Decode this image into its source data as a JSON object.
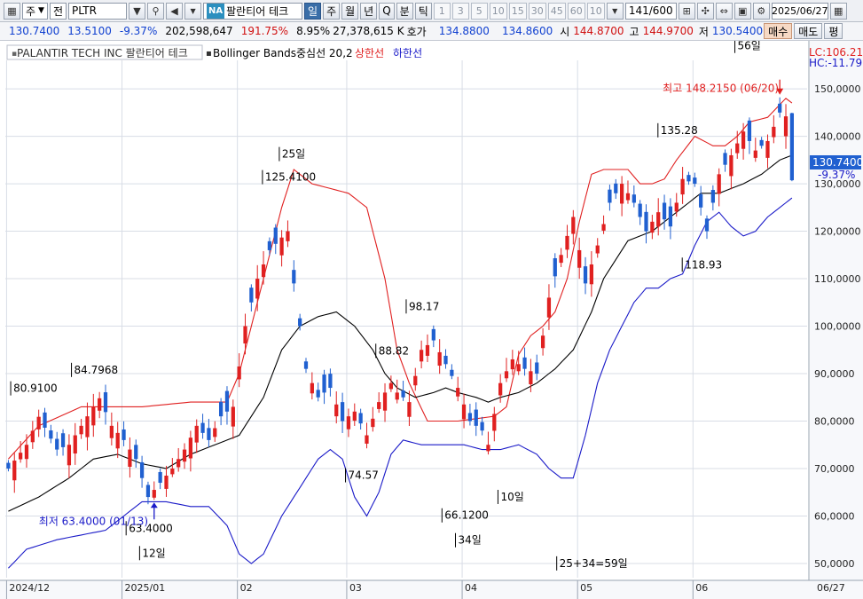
{
  "toolbar": {
    "mode1": "주",
    "mode2": "전",
    "symbol": "PLTR",
    "exchange_badge": "NA",
    "stock_name": "팔란티어 테크",
    "periods": [
      "일",
      "주",
      "월",
      "년",
      "Q",
      "분",
      "틱"
    ],
    "selected_period": "일",
    "intervals": [
      "1",
      "3",
      "5",
      "10",
      "15",
      "30",
      "45",
      "60",
      "10"
    ],
    "count": "141",
    "count_total": "/600",
    "date": "2025/06/27"
  },
  "quote": {
    "price": "130.7400",
    "change": "13.5100",
    "change_pct": "-9.37%",
    "volume": "202,598,647",
    "vol_ratio": "191.75%",
    "turnover_pct": "8.95%",
    "amount": "27,378,615 K",
    "bidask_label": "호가",
    "bid": "134.8800",
    "ask": "134.8600",
    "open_label": "시",
    "open": "144.8700",
    "high_label": "고",
    "high": "144.9700",
    "low_label": "저",
    "low": "130.5400",
    "buy_label": "매수",
    "sell_label": "매도",
    "eval_label": "평"
  },
  "legend": {
    "name": "PALANTIR TECH INC  팔란티어 테크",
    "bb_label": "Bollinger Bands중심선 20,2",
    "upper_label": "상한선",
    "lower_label": "하한선"
  },
  "right_badges": {
    "lc": "LC:106.21",
    "hc": "HC:-11.79",
    "last_price": "130.7400",
    "last_pct": "-9.37%"
  },
  "chart_data": {
    "type": "candlestick",
    "ylim": [
      47,
      156
    ],
    "y_ticks": [
      "150,0000",
      "140,0000",
      "130,0000",
      "120,0000",
      "110,0000",
      "100,0000",
      "90,0000",
      "80,0000",
      "70,0000",
      "60,0000",
      "50,0000"
    ],
    "y_tick_values": [
      150,
      140,
      130,
      120,
      110,
      100,
      90,
      80,
      70,
      60,
      50
    ],
    "x_labels": [
      "2024/12",
      "2025/01",
      "02",
      "03",
      "04",
      "05",
      "06",
      "06/27"
    ],
    "x_label_index": [
      0,
      19,
      38,
      56,
      75,
      94,
      113,
      132
    ],
    "n_candles": 130,
    "colors": {
      "up": "#e02020",
      "down": "#2060d0",
      "mid": "#000000",
      "upper": "#e02020",
      "lower": "#1a1ac8",
      "grid": "#d8dde6"
    },
    "anchors": {
      "close": [
        [
          0,
          70
        ],
        [
          3,
          75
        ],
        [
          5,
          80.9
        ],
        [
          8,
          74
        ],
        [
          10,
          75
        ],
        [
          13,
          81
        ],
        [
          15,
          84.8
        ],
        [
          17,
          79
        ],
        [
          19,
          76
        ],
        [
          21,
          72
        ],
        [
          23,
          64
        ],
        [
          25,
          67
        ],
        [
          27,
          70
        ],
        [
          29,
          74
        ],
        [
          31,
          79
        ],
        [
          33,
          76
        ],
        [
          35,
          81
        ],
        [
          37,
          83
        ],
        [
          39,
          100
        ],
        [
          41,
          110
        ],
        [
          43,
          116
        ],
        [
          46,
          120
        ],
        [
          47,
          109
        ],
        [
          49,
          91
        ],
        [
          51,
          85
        ],
        [
          53,
          87
        ],
        [
          55,
          80
        ],
        [
          57,
          82
        ],
        [
          59,
          77
        ],
        [
          61,
          84
        ],
        [
          63,
          88
        ],
        [
          64,
          86
        ],
        [
          66,
          84
        ],
        [
          68,
          95
        ],
        [
          70,
          97
        ],
        [
          72,
          92
        ],
        [
          74,
          87
        ],
        [
          76,
          80
        ],
        [
          78,
          78
        ],
        [
          79,
          75
        ],
        [
          81,
          88
        ],
        [
          83,
          93
        ],
        [
          85,
          91
        ],
        [
          87,
          90
        ],
        [
          89,
          106
        ],
        [
          91,
          115
        ],
        [
          93,
          123
        ],
        [
          95,
          109
        ],
        [
          97,
          117
        ],
        [
          99,
          126
        ],
        [
          101,
          130
        ],
        [
          103,
          126
        ],
        [
          105,
          120
        ],
        [
          107,
          124
        ],
        [
          109,
          121
        ],
        [
          111,
          131
        ],
        [
          113,
          130
        ],
        [
          115,
          120
        ],
        [
          117,
          132
        ],
        [
          119,
          136
        ],
        [
          121,
          141
        ],
        [
          123,
          137
        ],
        [
          125,
          139
        ],
        [
          127,
          145
        ],
        [
          128,
          144.2
        ],
        [
          129,
          130.74
        ]
      ],
      "upper": [
        [
          0,
          72
        ],
        [
          5,
          79
        ],
        [
          12,
          83
        ],
        [
          16,
          83
        ],
        [
          22,
          83
        ],
        [
          30,
          84
        ],
        [
          36,
          84
        ],
        [
          38,
          90
        ],
        [
          42,
          110
        ],
        [
          45,
          125
        ],
        [
          47,
          133
        ],
        [
          50,
          130
        ],
        [
          56,
          128
        ],
        [
          59,
          125
        ],
        [
          62,
          110
        ],
        [
          64,
          95
        ],
        [
          66,
          88
        ],
        [
          69,
          80
        ],
        [
          74,
          80
        ],
        [
          80,
          81
        ],
        [
          82,
          83
        ],
        [
          84,
          94
        ],
        [
          86,
          98
        ],
        [
          88,
          100
        ],
        [
          90,
          103
        ],
        [
          92,
          110
        ],
        [
          94,
          122
        ],
        [
          96,
          132
        ],
        [
          98,
          133
        ],
        [
          100,
          133
        ],
        [
          102,
          133
        ],
        [
          104,
          130
        ],
        [
          106,
          130
        ],
        [
          108,
          131
        ],
        [
          110,
          135
        ],
        [
          113,
          140
        ],
        [
          116,
          138
        ],
        [
          118,
          138
        ],
        [
          120,
          140
        ],
        [
          122,
          143
        ],
        [
          125,
          144
        ],
        [
          128,
          148
        ],
        [
          129,
          147
        ]
      ],
      "mid": [
        [
          0,
          61
        ],
        [
          5,
          64
        ],
        [
          10,
          68
        ],
        [
          14,
          72
        ],
        [
          18,
          73
        ],
        [
          22,
          71
        ],
        [
          26,
          70
        ],
        [
          30,
          73
        ],
        [
          34,
          75
        ],
        [
          38,
          77
        ],
        [
          42,
          85
        ],
        [
          45,
          95
        ],
        [
          48,
          100
        ],
        [
          51,
          102
        ],
        [
          54,
          103
        ],
        [
          57,
          100
        ],
        [
          60,
          95
        ],
        [
          62,
          90
        ],
        [
          64,
          87
        ],
        [
          67,
          85
        ],
        [
          70,
          86
        ],
        [
          72,
          87
        ],
        [
          74,
          86
        ],
        [
          77,
          85
        ],
        [
          79,
          84
        ],
        [
          81,
          85
        ],
        [
          84,
          86
        ],
        [
          87,
          88
        ],
        [
          90,
          91
        ],
        [
          93,
          95
        ],
        [
          96,
          103
        ],
        [
          98,
          110
        ],
        [
          100,
          114
        ],
        [
          102,
          118
        ],
        [
          104,
          119
        ],
        [
          106,
          120
        ],
        [
          108,
          122
        ],
        [
          110,
          124
        ],
        [
          112,
          126
        ],
        [
          114,
          128
        ],
        [
          117,
          128
        ],
        [
          119,
          129
        ],
        [
          121,
          130
        ],
        [
          124,
          132
        ],
        [
          127,
          135
        ],
        [
          129,
          136
        ]
      ],
      "lower": [
        [
          0,
          49
        ],
        [
          3,
          53
        ],
        [
          8,
          55
        ],
        [
          12,
          56
        ],
        [
          16,
          57
        ],
        [
          20,
          61
        ],
        [
          22,
          63
        ],
        [
          26,
          63
        ],
        [
          30,
          62
        ],
        [
          33,
          62
        ],
        [
          36,
          58
        ],
        [
          38,
          52
        ],
        [
          40,
          50
        ],
        [
          42,
          52
        ],
        [
          45,
          60
        ],
        [
          48,
          66
        ],
        [
          51,
          72
        ],
        [
          53,
          74
        ],
        [
          55,
          72
        ],
        [
          57,
          64
        ],
        [
          59,
          60
        ],
        [
          61,
          65
        ],
        [
          63,
          73
        ],
        [
          65,
          76
        ],
        [
          68,
          75
        ],
        [
          72,
          75
        ],
        [
          75,
          75
        ],
        [
          78,
          74
        ],
        [
          81,
          74
        ],
        [
          84,
          75
        ],
        [
          87,
          73
        ],
        [
          89,
          70
        ],
        [
          91,
          68
        ],
        [
          93,
          68
        ],
        [
          95,
          77
        ],
        [
          97,
          88
        ],
        [
          99,
          95
        ],
        [
          101,
          100
        ],
        [
          103,
          105
        ],
        [
          105,
          108
        ],
        [
          107,
          108
        ],
        [
          109,
          110
        ],
        [
          111,
          111
        ],
        [
          113,
          117
        ],
        [
          115,
          122
        ],
        [
          117,
          124
        ],
        [
          119,
          121
        ],
        [
          121,
          119
        ],
        [
          123,
          120
        ],
        [
          125,
          123
        ],
        [
          127,
          125
        ],
        [
          129,
          127
        ]
      ]
    },
    "annotations": [
      {
        "text": "80.9100",
        "idx": 5,
        "value": 80.91,
        "pos": "above"
      },
      {
        "text": "84.7968",
        "idx": 15,
        "value": 84.8,
        "pos": "above"
      },
      {
        "text": "63.4000",
        "idx": 24,
        "value": 63.4,
        "pos": "below"
      },
      {
        "text": "12일",
        "idx": 24,
        "value": 63.4,
        "pos": "below2"
      },
      {
        "text": "25일",
        "idx": 47,
        "value": 125.41,
        "pos": "above2"
      },
      {
        "text": "125.4100",
        "idx": 47,
        "value": 125.41,
        "pos": "above"
      },
      {
        "text": "74.57",
        "idx": 59,
        "value": 74.57,
        "pos": "below"
      },
      {
        "text": "88.82",
        "idx": 64,
        "value": 88.82,
        "pos": "above"
      },
      {
        "text": "98.17",
        "idx": 69,
        "value": 98.17,
        "pos": "above"
      },
      {
        "text": "66.1200",
        "idx": 76,
        "value": 66.12,
        "pos": "below"
      },
      {
        "text": "34일",
        "idx": 76,
        "value": 66.12,
        "pos": "below2"
      },
      {
        "text": "10일",
        "idx": 83,
        "value": 70,
        "pos": "below"
      },
      {
        "text": "25+34=59일",
        "idx": 96,
        "value": 56,
        "pos": "below"
      },
      {
        "text": "135.28",
        "idx": 111,
        "value": 135.28,
        "pos": "above"
      },
      {
        "text": "118.93",
        "idx": 115,
        "value": 118.93,
        "pos": "below"
      },
      {
        "text": "56일",
        "idx": 122,
        "value": 148.2,
        "pos": "above2"
      }
    ],
    "low_marker": {
      "text": "최저 63.4000 (01/13)",
      "idx": 24,
      "value": 63.4
    },
    "high_marker": {
      "text": "최고 148.2150 (06/20)",
      "idx": 127,
      "value": 148.2
    }
  }
}
